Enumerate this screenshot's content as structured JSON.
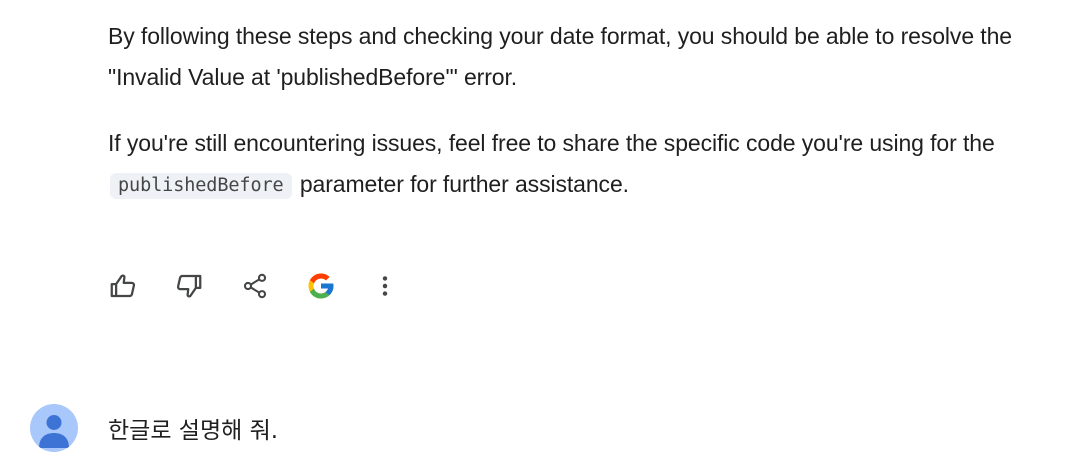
{
  "response": {
    "paragraph1": "By following these steps and checking your date format, you should be able to resolve the \"Invalid Value at 'publishedBefore'\" error.",
    "paragraph2_before": "If you're still encountering issues, feel free to share the specific code you're using for the ",
    "paragraph2_code": "publishedBefore",
    "paragraph2_after": " parameter for further assistance."
  },
  "actions": {
    "icons": [
      "thumb-up-icon",
      "thumb-down-icon",
      "share-icon",
      "google-icon",
      "more-vert-icon"
    ]
  },
  "user_prompt": {
    "text": "한글로 설명해 줘.",
    "avatar_color": "#a8c7fa",
    "avatar_figure_color": "#3e73d6"
  },
  "colors": {
    "text": "#1f1f1f",
    "icon": "#444746",
    "code_background": "#eef1f6"
  }
}
